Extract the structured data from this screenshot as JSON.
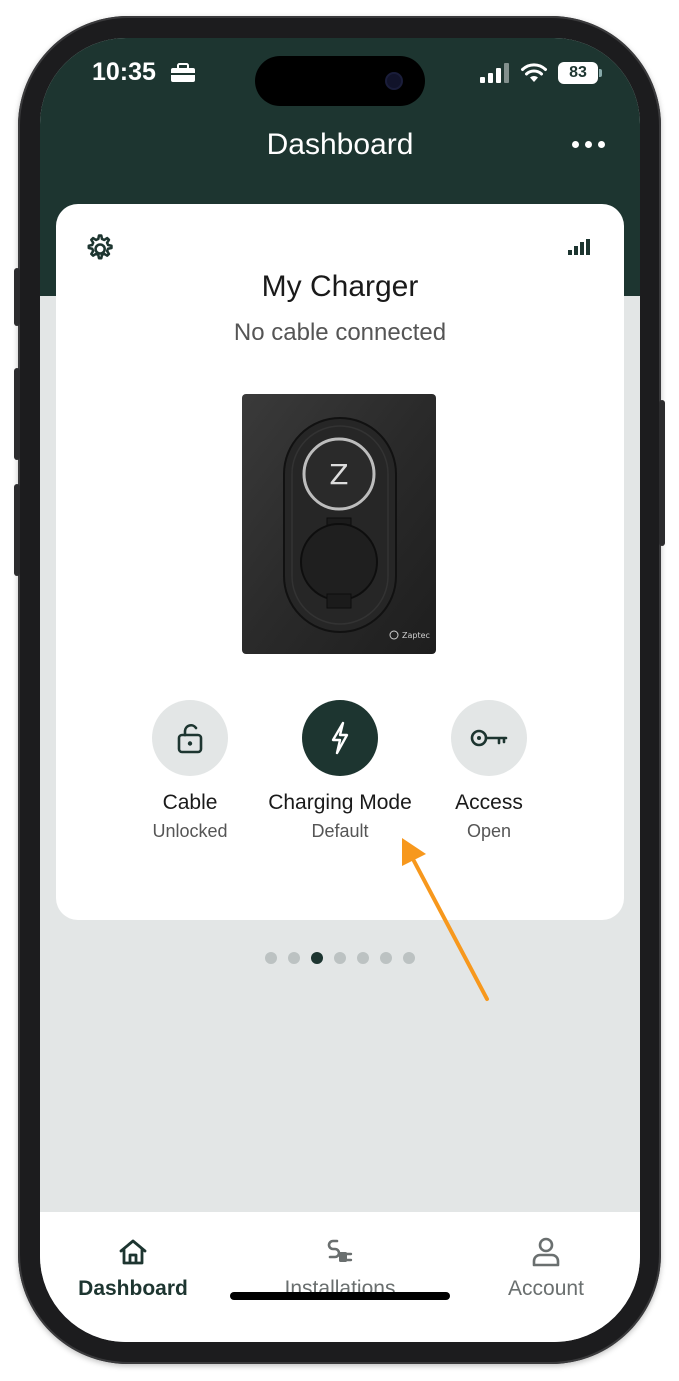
{
  "status_bar": {
    "time": "10:35",
    "battery": "83"
  },
  "header": {
    "title": "Dashboard"
  },
  "charger_card": {
    "name": "My Charger",
    "status": "No cable connected",
    "device_brand": "Zaptec",
    "actions": [
      {
        "label": "Cable",
        "value": "Unlocked",
        "icon": "unlock-icon"
      },
      {
        "label": "Charging Mode",
        "value": "Default",
        "icon": "lightning-icon"
      },
      {
        "label": "Access",
        "value": "Open",
        "icon": "key-icon"
      }
    ]
  },
  "pager": {
    "count": 7,
    "active_index": 2
  },
  "tab_bar": {
    "items": [
      {
        "label": "Dashboard",
        "icon": "home-icon",
        "active": true
      },
      {
        "label": "Installations",
        "icon": "plug-icon",
        "active": false
      },
      {
        "label": "Account",
        "icon": "person-icon",
        "active": false
      }
    ]
  },
  "colors": {
    "brand_dark": "#1d3530",
    "annotation_arrow": "#f7981d",
    "background": "#e3e6e6"
  }
}
